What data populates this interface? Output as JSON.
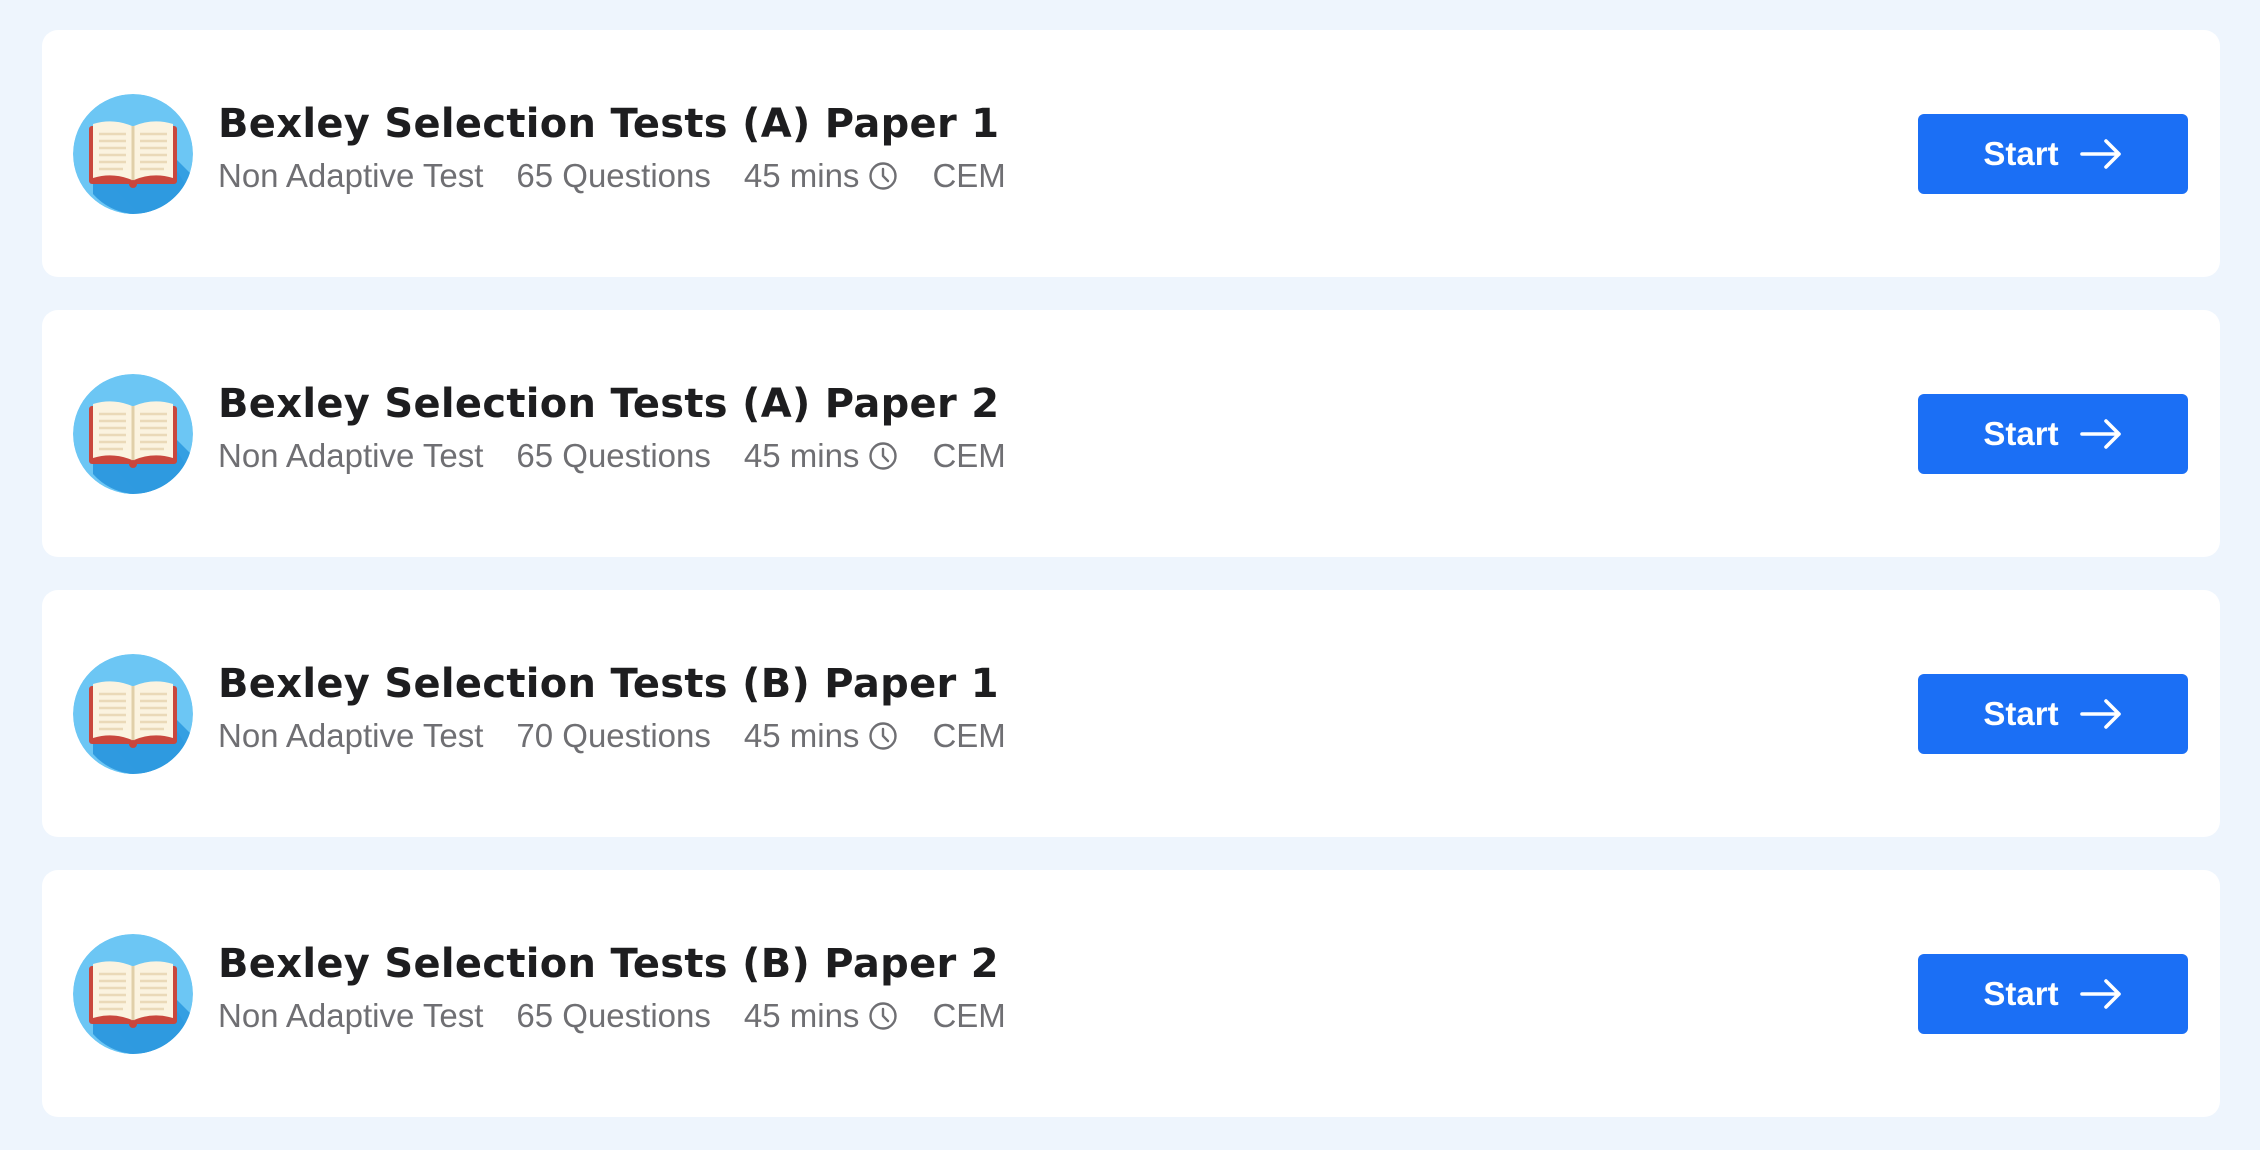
{
  "colors": {
    "page_background": "#eef5fd",
    "card_background": "#ffffff",
    "accent": "#1b6ff5",
    "title_text": "#1d1d1f",
    "meta_text": "#6f6f73",
    "avatar_blue": "#6cc6f4"
  },
  "icons": {
    "avatar": "open-book-icon",
    "duration": "clock-icon",
    "button": "arrow-right-icon"
  },
  "tests": [
    {
      "title": "Bexley Selection Tests (A) Paper 1",
      "type": "Non Adaptive Test",
      "questions": "65 Questions",
      "duration": "45 mins",
      "board": "CEM",
      "button_label": "Start"
    },
    {
      "title": "Bexley Selection Tests (A) Paper 2",
      "type": "Non Adaptive Test",
      "questions": "65 Questions",
      "duration": "45 mins",
      "board": "CEM",
      "button_label": "Start"
    },
    {
      "title": "Bexley Selection Tests (B) Paper 1",
      "type": "Non Adaptive Test",
      "questions": "70 Questions",
      "duration": "45 mins",
      "board": "CEM",
      "button_label": "Start"
    },
    {
      "title": "Bexley Selection Tests (B) Paper 2",
      "type": "Non Adaptive Test",
      "questions": "65 Questions",
      "duration": "45 mins",
      "board": "CEM",
      "button_label": "Start"
    }
  ]
}
